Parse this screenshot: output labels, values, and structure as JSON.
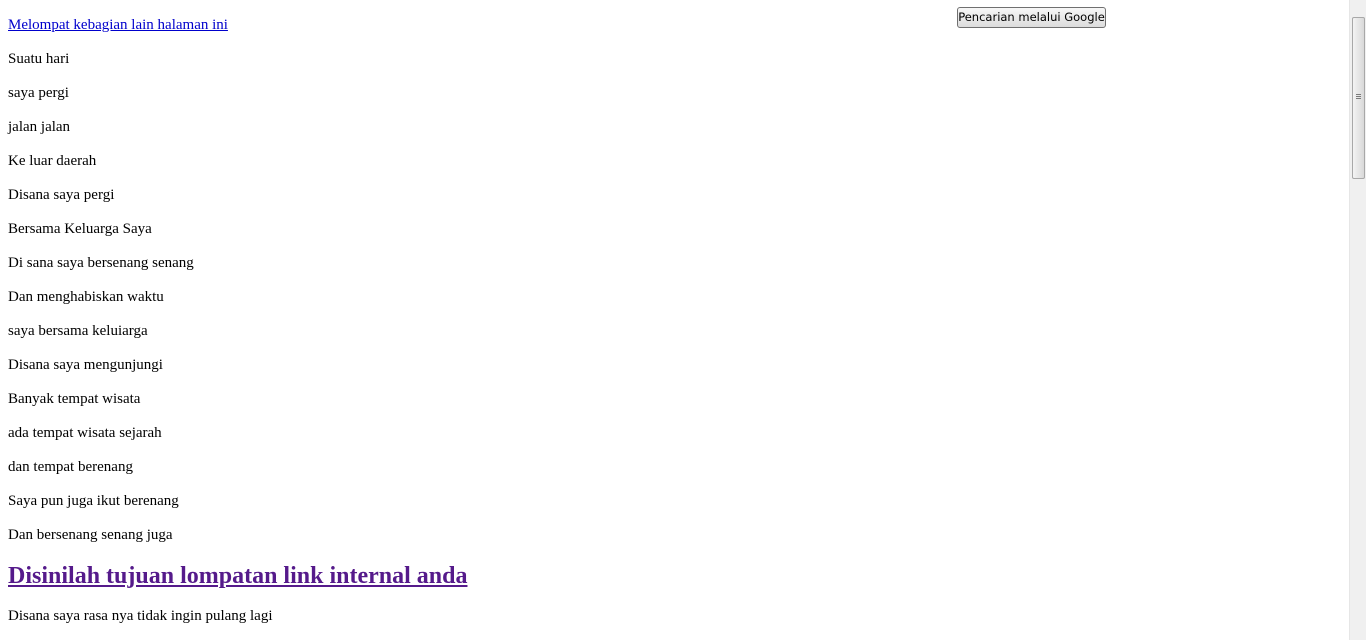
{
  "search_button": {
    "label": "Pencarian melalui Google"
  },
  "jump_link": {
    "label": "Melompat kebagian lain halaman ini"
  },
  "lines": [
    "Suatu hari",
    "saya pergi",
    "jalan jalan",
    "Ke luar daerah",
    "Disana saya pergi",
    "Bersama Keluarga Saya",
    "Di sana saya bersenang senang",
    "Dan menghabiskan waktu",
    "saya bersama keluiarga",
    "Disana saya mengunjungi",
    "Banyak tempat wisata",
    "ada tempat wisata sejarah",
    "dan tempat berenang",
    "Saya pun juga ikut berenang",
    "Dan bersenang senang juga"
  ],
  "heading": {
    "label": "Disinilah tujuan lompatan link internal anda"
  },
  "after_heading": [
    "Disana saya rasa nya tidak ingin pulang lagi"
  ],
  "colors": {
    "link": "#0000cc",
    "visited_heading": "#551a8b",
    "text": "#000000",
    "background": "#ffffff"
  }
}
